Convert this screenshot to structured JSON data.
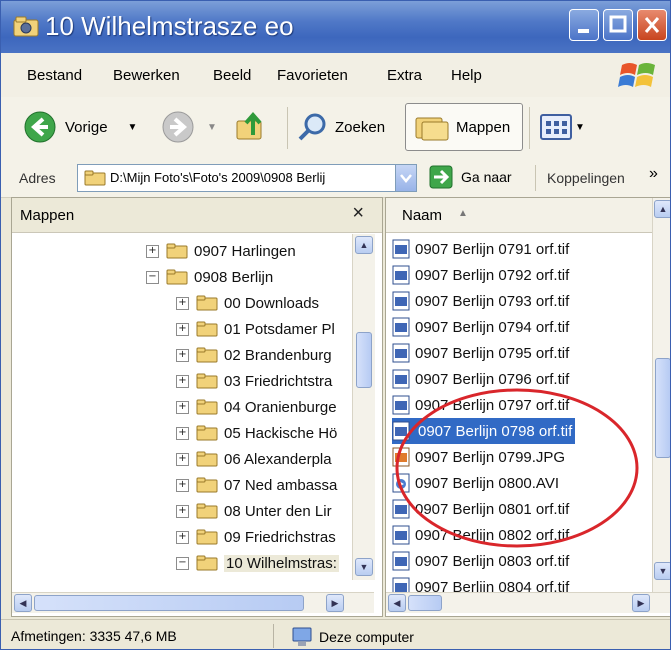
{
  "window": {
    "title": "10 Wilhelmstrasze eo"
  },
  "menu": [
    "Bestand",
    "Bewerken",
    "Beeld",
    "Favorieten",
    "Extra",
    "Help"
  ],
  "toolbar": {
    "back": "Vorige",
    "search": "Zoeken",
    "folders": "Mappen"
  },
  "address": {
    "label": "Adres",
    "value": "D:\\Mijn Foto's\\Foto's 2009\\0908 Berlij",
    "go": "Ga naar",
    "links": "Koppelingen",
    "more": "»"
  },
  "folders_pane": {
    "title": "Mappen",
    "close": "×",
    "items": [
      {
        "label": "0907 Harlingen",
        "expander": "+",
        "level": 1
      },
      {
        "label": "0908 Berlijn",
        "expander": "−",
        "level": 1
      },
      {
        "label": "00 Downloads",
        "expander": "+",
        "level": 2
      },
      {
        "label": "01 Potsdamer Pl",
        "expander": "+",
        "level": 2
      },
      {
        "label": "02 Brandenburg",
        "expander": "+",
        "level": 2
      },
      {
        "label": "03 Friedrichtstra",
        "expander": "+",
        "level": 2
      },
      {
        "label": "04 Oranienburge",
        "expander": "+",
        "level": 2
      },
      {
        "label": "05 Hackische Hö",
        "expander": "+",
        "level": 2
      },
      {
        "label": "06 Alexanderpla",
        "expander": "+",
        "level": 2
      },
      {
        "label": "07 Ned ambassa",
        "expander": "+",
        "level": 2
      },
      {
        "label": "08 Unter den Lir",
        "expander": "+",
        "level": 2
      },
      {
        "label": "09 Friedrichstras",
        "expander": "+",
        "level": 2
      },
      {
        "label": "10 Wilhelmstras:",
        "expander": "−",
        "level": 2
      }
    ]
  },
  "files_pane": {
    "column": "Naam",
    "sort_indicator": "▲",
    "files": [
      {
        "name": "0907 Berlijn 0791 orf.tif",
        "icon": "tif-file-icon"
      },
      {
        "name": "0907 Berlijn 0792 orf.tif",
        "icon": "tif-file-icon"
      },
      {
        "name": "0907 Berlijn 0793 orf.tif",
        "icon": "tif-file-icon"
      },
      {
        "name": "0907 Berlijn 0794 orf.tif",
        "icon": "tif-file-icon"
      },
      {
        "name": "0907 Berlijn 0795 orf.tif",
        "icon": "tif-file-icon"
      },
      {
        "name": "0907 Berlijn 0796 orf.tif",
        "icon": "tif-file-icon"
      },
      {
        "name": "0907 Berlijn 0797 orf.tif",
        "icon": "tif-file-icon"
      },
      {
        "name": "0907 Berlijn 0798 orf.tif",
        "icon": "tif-file-icon",
        "selected": true
      },
      {
        "name": "0907 Berlijn 0799.JPG",
        "icon": "jpg-file-icon"
      },
      {
        "name": "0907 Berlijn 0800.AVI",
        "icon": "avi-file-icon"
      },
      {
        "name": "0907 Berlijn 0801 orf.tif",
        "icon": "tif-file-icon"
      },
      {
        "name": "0907 Berlijn 0802 orf.tif",
        "icon": "tif-file-icon"
      },
      {
        "name": "0907 Berlijn 0803 orf.tif",
        "icon": "tif-file-icon"
      },
      {
        "name": "0907 Berlijn 0804 orf.tif",
        "icon": "tif-file-icon"
      }
    ]
  },
  "status": {
    "details": "Afmetingen: 3335 47,6 MB",
    "location": "Deze computer"
  },
  "colors": {
    "titlebar": "#3d67bd",
    "selection": "#316ac5",
    "highlight_ellipse": "#d9262b"
  }
}
